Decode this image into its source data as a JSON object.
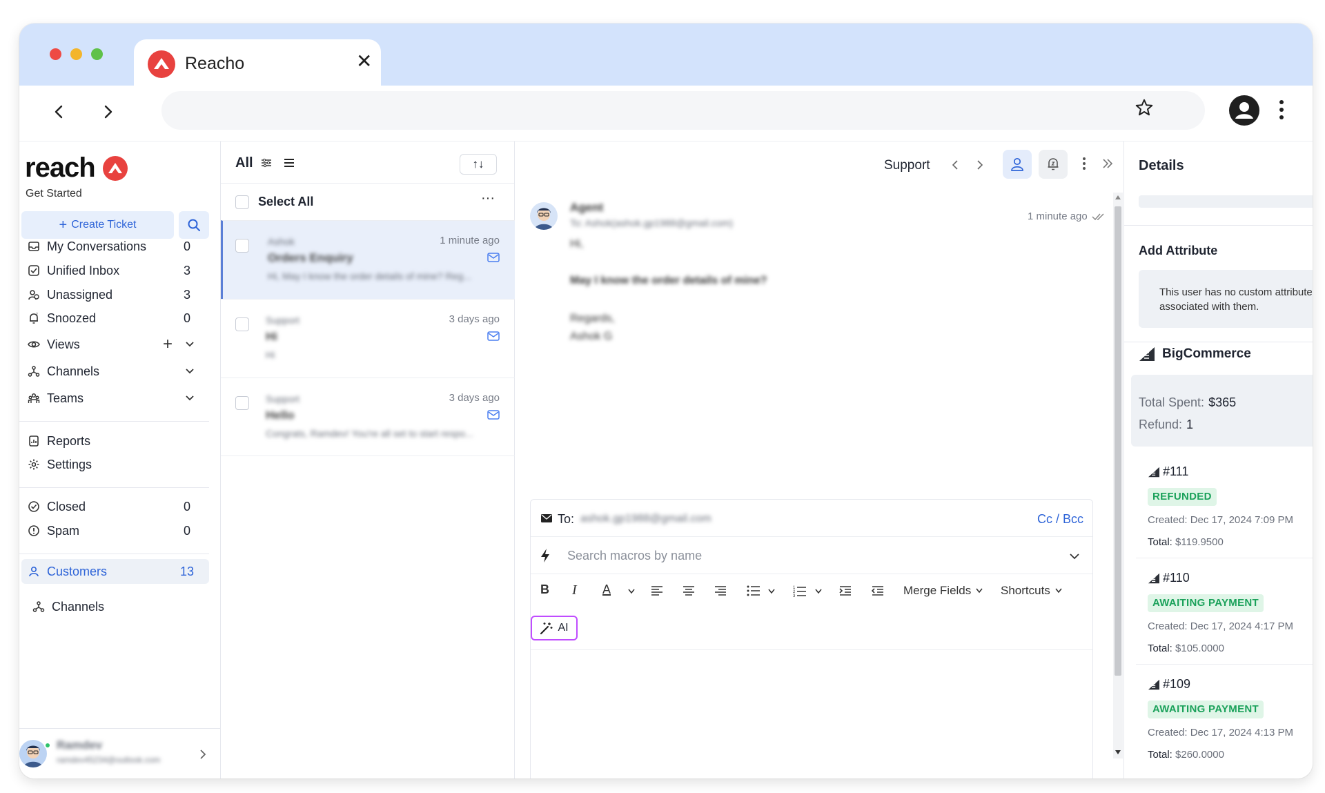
{
  "browser": {
    "tab_title": "Reacho",
    "tab_close": "✕"
  },
  "sidebar": {
    "brand": "reach",
    "subtitle": "Get Started",
    "create_ticket": "Create Ticket",
    "nav_primary": [
      {
        "label": "My Conversations",
        "count": "0",
        "icon": "inbox-icon"
      },
      {
        "label": "Unified Inbox",
        "count": "3",
        "icon": "unified-inbox-icon"
      },
      {
        "label": "Unassigned",
        "count": "3",
        "icon": "users-icon"
      },
      {
        "label": "Snoozed",
        "count": "0",
        "icon": "bell-snooze-icon"
      }
    ],
    "views": "Views",
    "channels": "Channels",
    "teams": "Teams",
    "reports": "Reports",
    "settings": "Settings",
    "closed": {
      "label": "Closed",
      "count": "0"
    },
    "spam": {
      "label": "Spam",
      "count": "0"
    },
    "customers": {
      "label": "Customers",
      "count": "13"
    },
    "channels_bottom": "Channels",
    "user": {
      "name": "Ramdev",
      "email": "ramdev45234@outlook.com"
    }
  },
  "list": {
    "filter_label": "All",
    "select_all": "Select All",
    "more": "···",
    "sort": "↑↓",
    "conversations": [
      {
        "name": "Ashok",
        "subject": "Orders Enquiry",
        "preview": "Hi, May I know the order details of mine? Reg...",
        "time": "1 minute ago",
        "active": true
      },
      {
        "name": "Support",
        "subject": "Hi",
        "preview": "Hi",
        "time": "3 days ago",
        "active": false
      },
      {
        "name": "Support",
        "subject": "Hello",
        "preview": "Congrats, Ramdev! You're all set to start respo...",
        "time": "3 days ago",
        "active": false
      }
    ]
  },
  "chat": {
    "inbox_label": "Support",
    "message": {
      "sender": "Agent",
      "to": "To: Ashok(ashok.gp1988@gmail.com)",
      "time": "1 minute ago",
      "body": [
        "Hi,",
        "May I know the order details of mine?",
        "Regards,",
        "Ashok G"
      ]
    },
    "composer": {
      "to_label": "To:",
      "to_value": "ashok.gp1988@gmail.com",
      "cc_bcc": "Cc / Bcc",
      "macro_placeholder": "Search macros by name",
      "merge_fields": "Merge Fields",
      "shortcuts": "Shortcuts",
      "ai_label": "AI"
    }
  },
  "details": {
    "title": "Details",
    "add_attribute": "Add Attribute",
    "attr_empty_line1": "This user has no custom attributes",
    "attr_empty_line2": "associated with them.",
    "integration": "BigCommerce",
    "total_spent_label": "Total Spent:",
    "total_spent_value": "$365",
    "refund_label": "Refund:",
    "refund_value": "1",
    "orders": [
      {
        "number": "#111",
        "status": "REFUNDED",
        "created_label": "Created:",
        "created": "Dec 17, 2024 7:09 PM",
        "total_label": "Total:",
        "total": "$119.9500"
      },
      {
        "number": "#110",
        "status": "AWAITING PAYMENT",
        "created_label": "Created:",
        "created": "Dec 17, 2024 4:17 PM",
        "total_label": "Total:",
        "total": "$105.0000"
      },
      {
        "number": "#109",
        "status": "AWAITING PAYMENT",
        "created_label": "Created:",
        "created": "Dec 17, 2024 4:13 PM",
        "total_label": "Total:",
        "total": "$260.0000"
      }
    ]
  },
  "colors": {
    "accent": "#2e64d8",
    "brand_red": "#e8423f",
    "titlebar": "#d3e3fc",
    "badge_green": "#1aa15a",
    "ai_border": "#c04cff"
  }
}
